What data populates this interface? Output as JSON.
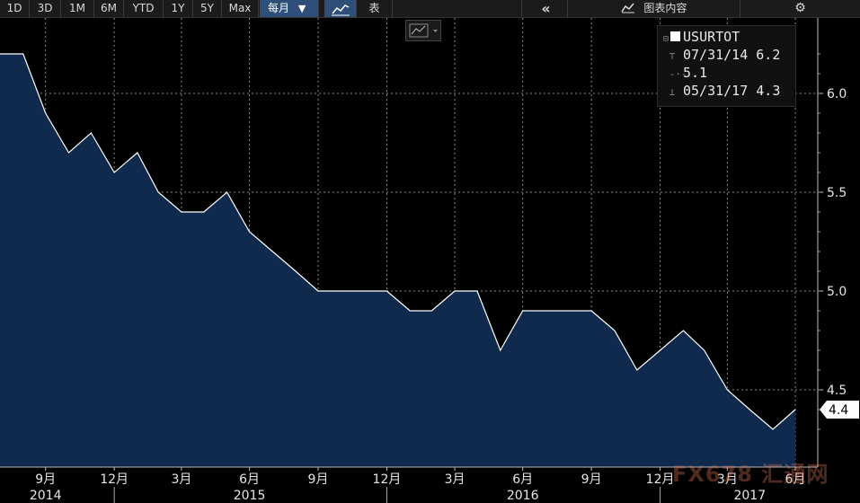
{
  "toolbar": {
    "ranges": [
      "1D",
      "3D",
      "1M",
      "6M",
      "YTD",
      "1Y",
      "5Y",
      "Max"
    ],
    "frequency": "每月",
    "frequency_arrow": "▼",
    "table_label": "表",
    "back_icon": "double-chevron-left-icon",
    "chart_content_label": "图表内容",
    "chart_content_icon": "area-chart-icon",
    "settings_icon": "gear-icon"
  },
  "legend": {
    "ticker": "USURTOT",
    "high": "07/31/14 6.2",
    "avg": "5.1",
    "low": "05/31/17 4.3"
  },
  "last_value_label": "4.4",
  "watermark": "FX678 汇通网",
  "colors": {
    "background": "#000000",
    "area_fill": "#0f2a4c",
    "line": "#ffffff",
    "grid": "#8a8a8a",
    "accent": "#2d4f79"
  },
  "chart_data": {
    "type": "area",
    "series": [
      {
        "name": "USURTOT",
        "x": [
          "2014-07-31",
          "2014-08-31",
          "2014-09-30",
          "2014-10-31",
          "2014-11-30",
          "2014-12-31",
          "2015-01-31",
          "2015-02-28",
          "2015-03-31",
          "2015-04-30",
          "2015-05-31",
          "2015-06-30",
          "2015-07-31",
          "2015-08-31",
          "2015-09-30",
          "2015-10-31",
          "2015-11-30",
          "2015-12-31",
          "2016-01-31",
          "2016-02-29",
          "2016-03-31",
          "2016-04-30",
          "2016-05-31",
          "2016-06-30",
          "2016-07-31",
          "2016-08-31",
          "2016-09-30",
          "2016-10-31",
          "2016-11-30",
          "2016-12-31",
          "2017-01-31",
          "2017-02-28",
          "2017-03-31",
          "2017-04-30",
          "2017-05-31",
          "2017-06-30"
        ],
        "values": [
          6.2,
          6.2,
          5.9,
          5.7,
          5.8,
          5.6,
          5.7,
          5.5,
          5.4,
          5.4,
          5.5,
          5.3,
          5.2,
          5.1,
          5.0,
          5.0,
          5.0,
          5.0,
          4.9,
          4.9,
          5.0,
          5.0,
          4.7,
          4.9,
          4.9,
          4.9,
          4.9,
          4.8,
          4.6,
          4.7,
          4.8,
          4.7,
          4.5,
          4.4,
          4.3,
          4.4
        ]
      }
    ],
    "yticks": [
      6.0,
      5.5,
      5.0,
      4.5
    ],
    "ylim": [
      4.2,
      6.35
    ],
    "month_labels": [
      {
        "date": "2014-09-30",
        "label": "9月"
      },
      {
        "date": "2014-12-31",
        "label": "12月"
      },
      {
        "date": "2015-03-31",
        "label": "3月"
      },
      {
        "date": "2015-06-30",
        "label": "6月"
      },
      {
        "date": "2015-09-30",
        "label": "9月"
      },
      {
        "date": "2015-12-31",
        "label": "12月"
      },
      {
        "date": "2016-03-31",
        "label": "3月"
      },
      {
        "date": "2016-06-30",
        "label": "6月"
      },
      {
        "date": "2016-09-30",
        "label": "9月"
      },
      {
        "date": "2016-12-31",
        "label": "12月"
      },
      {
        "date": "2017-03-31",
        "label": "3月"
      },
      {
        "date": "2017-06-30",
        "label": "6月"
      }
    ],
    "year_labels": [
      {
        "date": "2014-09-30",
        "label": "2014"
      },
      {
        "date": "2015-06-30",
        "label": "2015"
      },
      {
        "date": "2016-06-30",
        "label": "2016"
      },
      {
        "date": "2017-04-30",
        "label": "2017"
      }
    ],
    "year_dividers": [
      "2014-12-31",
      "2015-12-31",
      "2016-12-31"
    ],
    "grid": true,
    "legend_position": "top-right"
  }
}
